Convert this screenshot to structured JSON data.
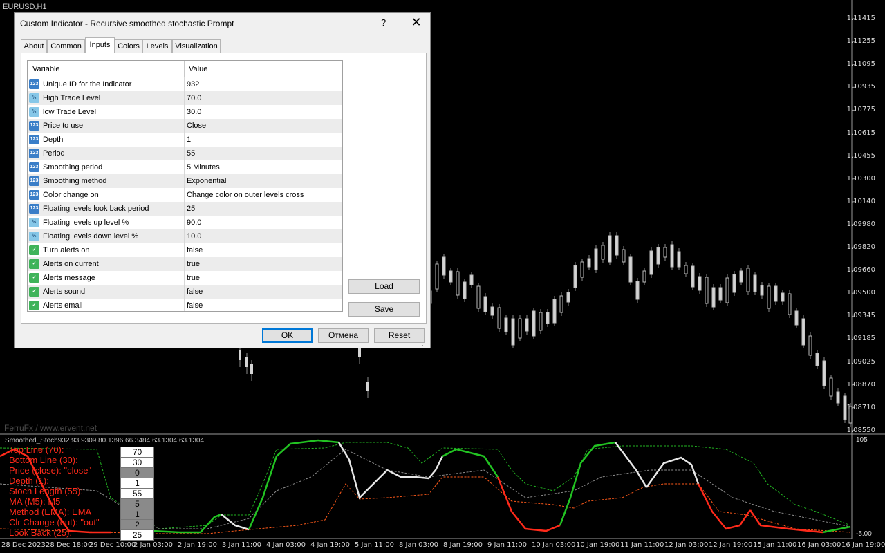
{
  "window": {
    "symbol": "EURUSD,H1"
  },
  "watermark": "FerruFx / www.ervent.net",
  "price_axis": [
    "1.11415",
    "1.11255",
    "1.11095",
    "1.10935",
    "1.10775",
    "1.10615",
    "1.10455",
    "1.10300",
    "1.10140",
    "1.09980",
    "1.09820",
    "1.09660",
    "1.09500",
    "1.09345",
    "1.09185",
    "1.09025",
    "1.08870",
    "1.08710",
    "1.08550"
  ],
  "time_axis": [
    "28 Dec 2023",
    "28 Dec 18:00",
    "29 Dec 10:00",
    "2 Jan 03:00",
    "2 Jan 19:00",
    "3 Jan 11:00",
    "4 Jan 03:00",
    "4 Jan 19:00",
    "5 Jan 11:00",
    "8 Jan 03:00",
    "8 Jan 19:00",
    "9 Jan 11:00",
    "10 Jan 03:00",
    "10 Jan 19:00",
    "11 Jan 11:00",
    "12 Jan 03:00",
    "12 Jan 19:00",
    "15 Jan 11:00",
    "16 Jan 03:00",
    "16 Jan 19:00"
  ],
  "indicator": {
    "title": "Smoothed_Stoch932 93.9309 80.1396 66.3484 63.1304 63.1304",
    "scale_top": "105",
    "scale_bottom": "-5.00",
    "labels": [
      {
        "label": "Top Line (70):",
        "value": "70"
      },
      {
        "label": "Bottom Line (30):",
        "value": "30"
      },
      {
        "label": "Price (close): \"close\"",
        "value": "0"
      },
      {
        "label": "Depth (1):",
        "value": "1"
      },
      {
        "label": "Stoch Length (55):",
        "value": "55"
      },
      {
        "label": "MA (M5): M5",
        "value": "5"
      },
      {
        "label": "Method (EMA): EMA",
        "value": "1"
      },
      {
        "label": "Clr Change (out): \"out\"",
        "value": "2"
      },
      {
        "label": "Look Back (25):",
        "value": "25"
      }
    ]
  },
  "dialog": {
    "title": "Custom Indicator - Recursive smoothed stochastic Prompt",
    "help": "?",
    "close": "✕",
    "tabs": [
      "About",
      "Common",
      "Inputs",
      "Colors",
      "Levels",
      "Visualization"
    ],
    "active_tab": "Inputs",
    "columns": {
      "variable": "Variable",
      "value": "Value"
    },
    "rows": [
      {
        "type": "int",
        "name": "Unique ID for the Indicator",
        "value": "932"
      },
      {
        "type": "dbl",
        "name": "High Trade Level",
        "value": "70.0"
      },
      {
        "type": "dbl",
        "name": "low Trade Level",
        "value": "30.0"
      },
      {
        "type": "int",
        "name": "Price to use",
        "value": "Close"
      },
      {
        "type": "int",
        "name": "Depth",
        "value": "1"
      },
      {
        "type": "int",
        "name": "Period",
        "value": "55"
      },
      {
        "type": "int",
        "name": "Smoothing period",
        "value": "5 Minutes"
      },
      {
        "type": "int",
        "name": "Smoothing method",
        "value": "Exponential"
      },
      {
        "type": "int",
        "name": "Color change on",
        "value": "Change color on outer levels cross"
      },
      {
        "type": "int",
        "name": "Floating levels look back period",
        "value": "25"
      },
      {
        "type": "dbl",
        "name": "Floating levels up level %",
        "value": "90.0"
      },
      {
        "type": "dbl",
        "name": "Floating levels down level %",
        "value": "10.0"
      },
      {
        "type": "bool",
        "name": "Turn alerts on",
        "value": "false"
      },
      {
        "type": "bool",
        "name": "Alerts on current",
        "value": "true"
      },
      {
        "type": "bool",
        "name": "Alerts message",
        "value": "true"
      },
      {
        "type": "bool",
        "name": "Alerts sound",
        "value": "false"
      },
      {
        "type": "bool",
        "name": "Alerts email",
        "value": "false"
      }
    ],
    "icon_text": {
      "int": "123",
      "dbl": "½",
      "bool": "✓"
    },
    "buttons": {
      "load": "Load",
      "save": "Save",
      "ok": "OK",
      "cancel": "Отмена",
      "reset": "Reset"
    }
  }
}
